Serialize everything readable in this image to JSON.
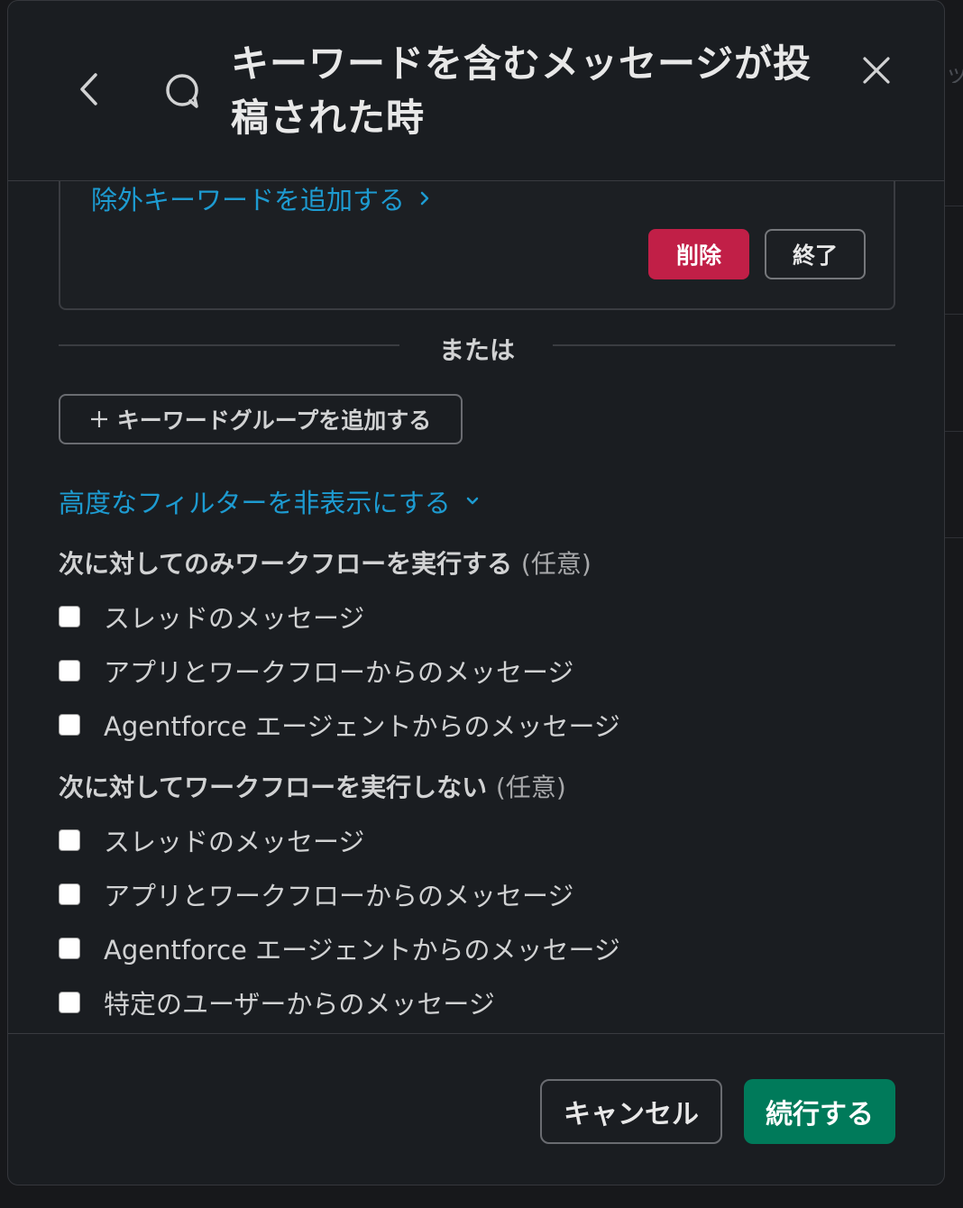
{
  "header": {
    "title": "キーワードを含むメッセージが投稿された時",
    "back_icon": "chevron-left-icon",
    "trigger_icon": "message-bubble-icon",
    "close_icon": "close-icon"
  },
  "keyword_group": {
    "exclude_link": "除外キーワードを追加する",
    "delete_label": "削除",
    "done_label": "終了"
  },
  "divider": {
    "label": "または"
  },
  "add_group": {
    "icon": "plus-icon",
    "label": "キーワードグループを追加する"
  },
  "filter_toggle": {
    "label": "高度なフィルターを非表示にする",
    "icon": "chevron-down-icon"
  },
  "only_section": {
    "title": "次に対してのみワークフローを実行する",
    "optional": "(任意)",
    "options": [
      {
        "label": "スレッドのメッセージ",
        "checked": false
      },
      {
        "label": "アプリとワークフローからのメッセージ",
        "checked": false
      },
      {
        "label": "Agentforce エージェントからのメッセージ",
        "checked": false
      }
    ]
  },
  "not_section": {
    "title": "次に対してワークフローを実行しない",
    "optional": "(任意)",
    "options": [
      {
        "label": "スレッドのメッセージ",
        "checked": false
      },
      {
        "label": "アプリとワークフローからのメッセージ",
        "checked": false
      },
      {
        "label": "Agentforce エージェントからのメッセージ",
        "checked": false
      },
      {
        "label": "特定のユーザーからのメッセージ",
        "checked": false
      }
    ]
  },
  "footer": {
    "cancel_label": "キャンセル",
    "continue_label": "続行する"
  },
  "colors": {
    "link": "#1d9bd1",
    "danger": "#c11f47",
    "primary": "#007a5a",
    "modal_bg": "#1a1d21"
  }
}
